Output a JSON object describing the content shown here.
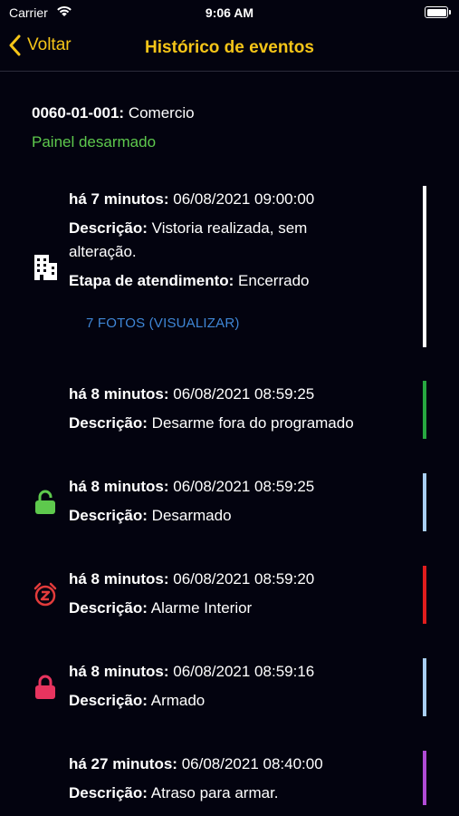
{
  "status_bar": {
    "carrier": "Carrier",
    "time": "9:06 AM",
    "icons": [
      "wifi-icon",
      "battery-icon"
    ]
  },
  "nav": {
    "back_label": "Voltar",
    "title": "Histórico de eventos",
    "accent_color": "#f5c518"
  },
  "header": {
    "account_code": "0060-01-001:",
    "account_name": "Comercio",
    "panel_status": "Painel desarmado",
    "panel_status_color": "#5ec94d"
  },
  "labels": {
    "description": "Descrição:",
    "stage": "Etapa de atendimento:"
  },
  "events": [
    {
      "time_ago": "há 7 minutos:",
      "datetime": "06/08/2021 09:00:00",
      "description_line1": "Vistoria realizada, sem",
      "description_line2": "alteração.",
      "stage": "Encerrado",
      "photos_link": "7 FOTOS (VISUALIZAR)",
      "icon": "building-icon",
      "bar_color": "#ffffff"
    },
    {
      "time_ago": "há 8 minutos:",
      "datetime": "06/08/2021 08:59:25",
      "description": "Desarme fora do programado",
      "icon": "",
      "bar_color": "#27a840"
    },
    {
      "time_ago": "há 8 minutos:",
      "datetime": "06/08/2021 08:59:25",
      "description": "Desarmado",
      "icon": "unlocked-padlock-icon",
      "icon_color": "#5ec94d",
      "bar_color": "#a9cff2"
    },
    {
      "time_ago": "há 8 minutos:",
      "datetime": "06/08/2021 08:59:20",
      "description": "Alarme Interior",
      "icon": "alarm-clock-icon",
      "icon_color": "#e23b3b",
      "bar_color": "#e11d1d"
    },
    {
      "time_ago": "há 8 minutos:",
      "datetime": "06/08/2021 08:59:16",
      "description": "Armado",
      "icon": "locked-padlock-icon",
      "icon_color": "#e8345f",
      "bar_color": "#a9cff2"
    },
    {
      "time_ago": "há 27 minutos:",
      "datetime": "06/08/2021 08:40:00",
      "description": "Atraso para armar.",
      "icon": "",
      "bar_color": "#b04bd6"
    }
  ]
}
